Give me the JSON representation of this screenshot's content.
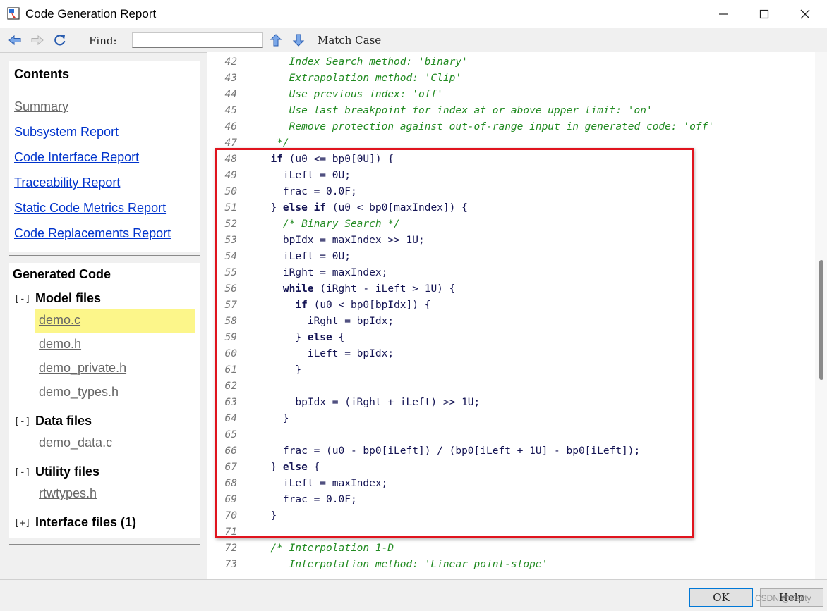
{
  "window": {
    "title": "Code Generation Report",
    "minimize_label": "—",
    "maximize_label": "□",
    "close_label": "✕"
  },
  "toolbar": {
    "find_label": "Find:",
    "find_value": "",
    "match_case_label": "Match Case",
    "back_icon": "arrow-left-icon",
    "forward_icon": "arrow-right-icon",
    "refresh_icon": "refresh-icon",
    "find_up_icon": "arrow-up-icon",
    "find_down_icon": "arrow-down-icon"
  },
  "contents": {
    "title": "Contents",
    "links": [
      {
        "label": "Summary",
        "visited": true
      },
      {
        "label": "Subsystem Report",
        "visited": false
      },
      {
        "label": "Code Interface Report",
        "visited": false
      },
      {
        "label": "Traceability Report",
        "visited": false
      },
      {
        "label": "Static Code Metrics Report",
        "visited": false
      },
      {
        "label": "Code Replacements Report",
        "visited": false
      }
    ]
  },
  "generated_code": {
    "title": "Generated Code",
    "groups": [
      {
        "toggle": "[-]",
        "label": "Model files",
        "files": [
          "demo.c",
          "demo.h",
          "demo_private.h",
          "demo_types.h"
        ],
        "selected": "demo.c"
      },
      {
        "toggle": "[-]",
        "label": "Data files",
        "files": [
          "demo_data.c"
        ]
      },
      {
        "toggle": "[-]",
        "label": "Utility files",
        "files": [
          "rtwtypes.h"
        ]
      },
      {
        "toggle": "[+]",
        "label": "Interface files (1)",
        "files": []
      }
    ]
  },
  "code": {
    "lines": [
      {
        "n": "42",
        "text": "     Index Search method: 'binary'",
        "comment": true
      },
      {
        "n": "43",
        "text": "     Extrapolation method: 'Clip'",
        "comment": true
      },
      {
        "n": "44",
        "text": "     Use previous index: 'off'",
        "comment": true
      },
      {
        "n": "45",
        "text": "     Use last breakpoint for index at or above upper limit: 'on'",
        "comment": true
      },
      {
        "n": "46",
        "text": "     Remove protection against out-of-range input in generated code: 'off'",
        "comment": true
      },
      {
        "n": "47",
        "text": "   */",
        "comment": true
      },
      {
        "n": "48",
        "text": "  if (u0 <= bp0[0U]) {",
        "kw": [
          "if"
        ]
      },
      {
        "n": "49",
        "text": "    iLeft = 0U;"
      },
      {
        "n": "50",
        "text": "    frac = 0.0F;"
      },
      {
        "n": "51",
        "text": "  } else if (u0 < bp0[maxIndex]) {",
        "kw": [
          "else",
          "if"
        ]
      },
      {
        "n": "52",
        "text": "    /* Binary Search */",
        "comment": true
      },
      {
        "n": "53",
        "text": "    bpIdx = maxIndex >> 1U;"
      },
      {
        "n": "54",
        "text": "    iLeft = 0U;"
      },
      {
        "n": "55",
        "text": "    iRght = maxIndex;"
      },
      {
        "n": "56",
        "text": "    while (iRght - iLeft > 1U) {",
        "kw": [
          "while"
        ]
      },
      {
        "n": "57",
        "text": "      if (u0 < bp0[bpIdx]) {",
        "kw": [
          "if"
        ]
      },
      {
        "n": "58",
        "text": "        iRght = bpIdx;"
      },
      {
        "n": "59",
        "text": "      } else {",
        "kw": [
          "else"
        ]
      },
      {
        "n": "60",
        "text": "        iLeft = bpIdx;"
      },
      {
        "n": "61",
        "text": "      }"
      },
      {
        "n": "62",
        "text": ""
      },
      {
        "n": "63",
        "text": "      bpIdx = (iRght + iLeft) >> 1U;"
      },
      {
        "n": "64",
        "text": "    }"
      },
      {
        "n": "65",
        "text": ""
      },
      {
        "n": "66",
        "text": "    frac = (u0 - bp0[iLeft]) / (bp0[iLeft + 1U] - bp0[iLeft]);"
      },
      {
        "n": "67",
        "text": "  } else {",
        "kw": [
          "else"
        ]
      },
      {
        "n": "68",
        "text": "    iLeft = maxIndex;"
      },
      {
        "n": "69",
        "text": "    frac = 0.0F;"
      },
      {
        "n": "70",
        "text": "  }"
      },
      {
        "n": "71",
        "text": ""
      },
      {
        "n": "72",
        "text": "  /* Interpolation 1-D",
        "comment": true
      },
      {
        "n": "73",
        "text": "     Interpolation method: 'Linear point-slope'",
        "comment": true
      }
    ]
  },
  "buttons": {
    "ok_label": "OK",
    "help_label": "Help"
  },
  "watermark": "CSDN @Kaitty",
  "colors": {
    "link": "#0033cc",
    "visited_link": "#666666",
    "comment": "#228b22",
    "highlight_box": "#e0141e",
    "selected_file": "#fcf68a"
  }
}
